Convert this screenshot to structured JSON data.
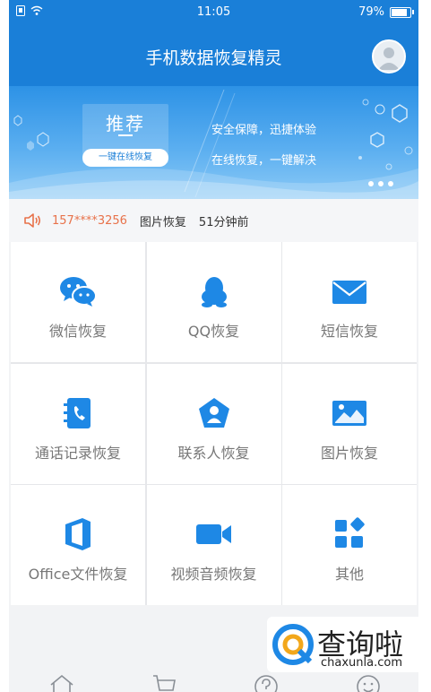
{
  "status_bar": {
    "time": "11:05",
    "battery": "79%",
    "battery_level": 0.79
  },
  "header": {
    "title": "手机数据恢复精灵"
  },
  "banner": {
    "badge_text": "推荐",
    "button_label": "一键在线恢复",
    "slogan_line1": "安全保障，迅捷体验",
    "slogan_line2": "在线恢复，一键解决"
  },
  "notice": {
    "phone": "157****3256",
    "type": "图片恢复",
    "time_ago": "51分钟前"
  },
  "grid_items": [
    {
      "label": "微信恢复",
      "icon": "wechat-icon"
    },
    {
      "label": "QQ恢复",
      "icon": "qq-penguin-icon"
    },
    {
      "label": "短信恢复",
      "icon": "envelope-icon"
    },
    {
      "label": "通话记录恢复",
      "icon": "call-log-icon"
    },
    {
      "label": "联系人恢复",
      "icon": "contact-icon"
    },
    {
      "label": "图片恢复",
      "icon": "picture-icon"
    },
    {
      "label": "Office文件恢复",
      "icon": "office-icon"
    },
    {
      "label": "视频音频恢复",
      "icon": "video-camera-icon"
    },
    {
      "label": "其他",
      "icon": "apps-icon"
    }
  ],
  "bottom_tabs": [
    "home-icon",
    "cart-icon",
    "help-icon",
    "smile-icon"
  ],
  "watermark": {
    "name": "查询啦",
    "url": "chaxunla.com"
  },
  "colors": {
    "primary": "#1a7fd8",
    "accent": "#e8724a",
    "icon_blue": "#1e88e5"
  }
}
